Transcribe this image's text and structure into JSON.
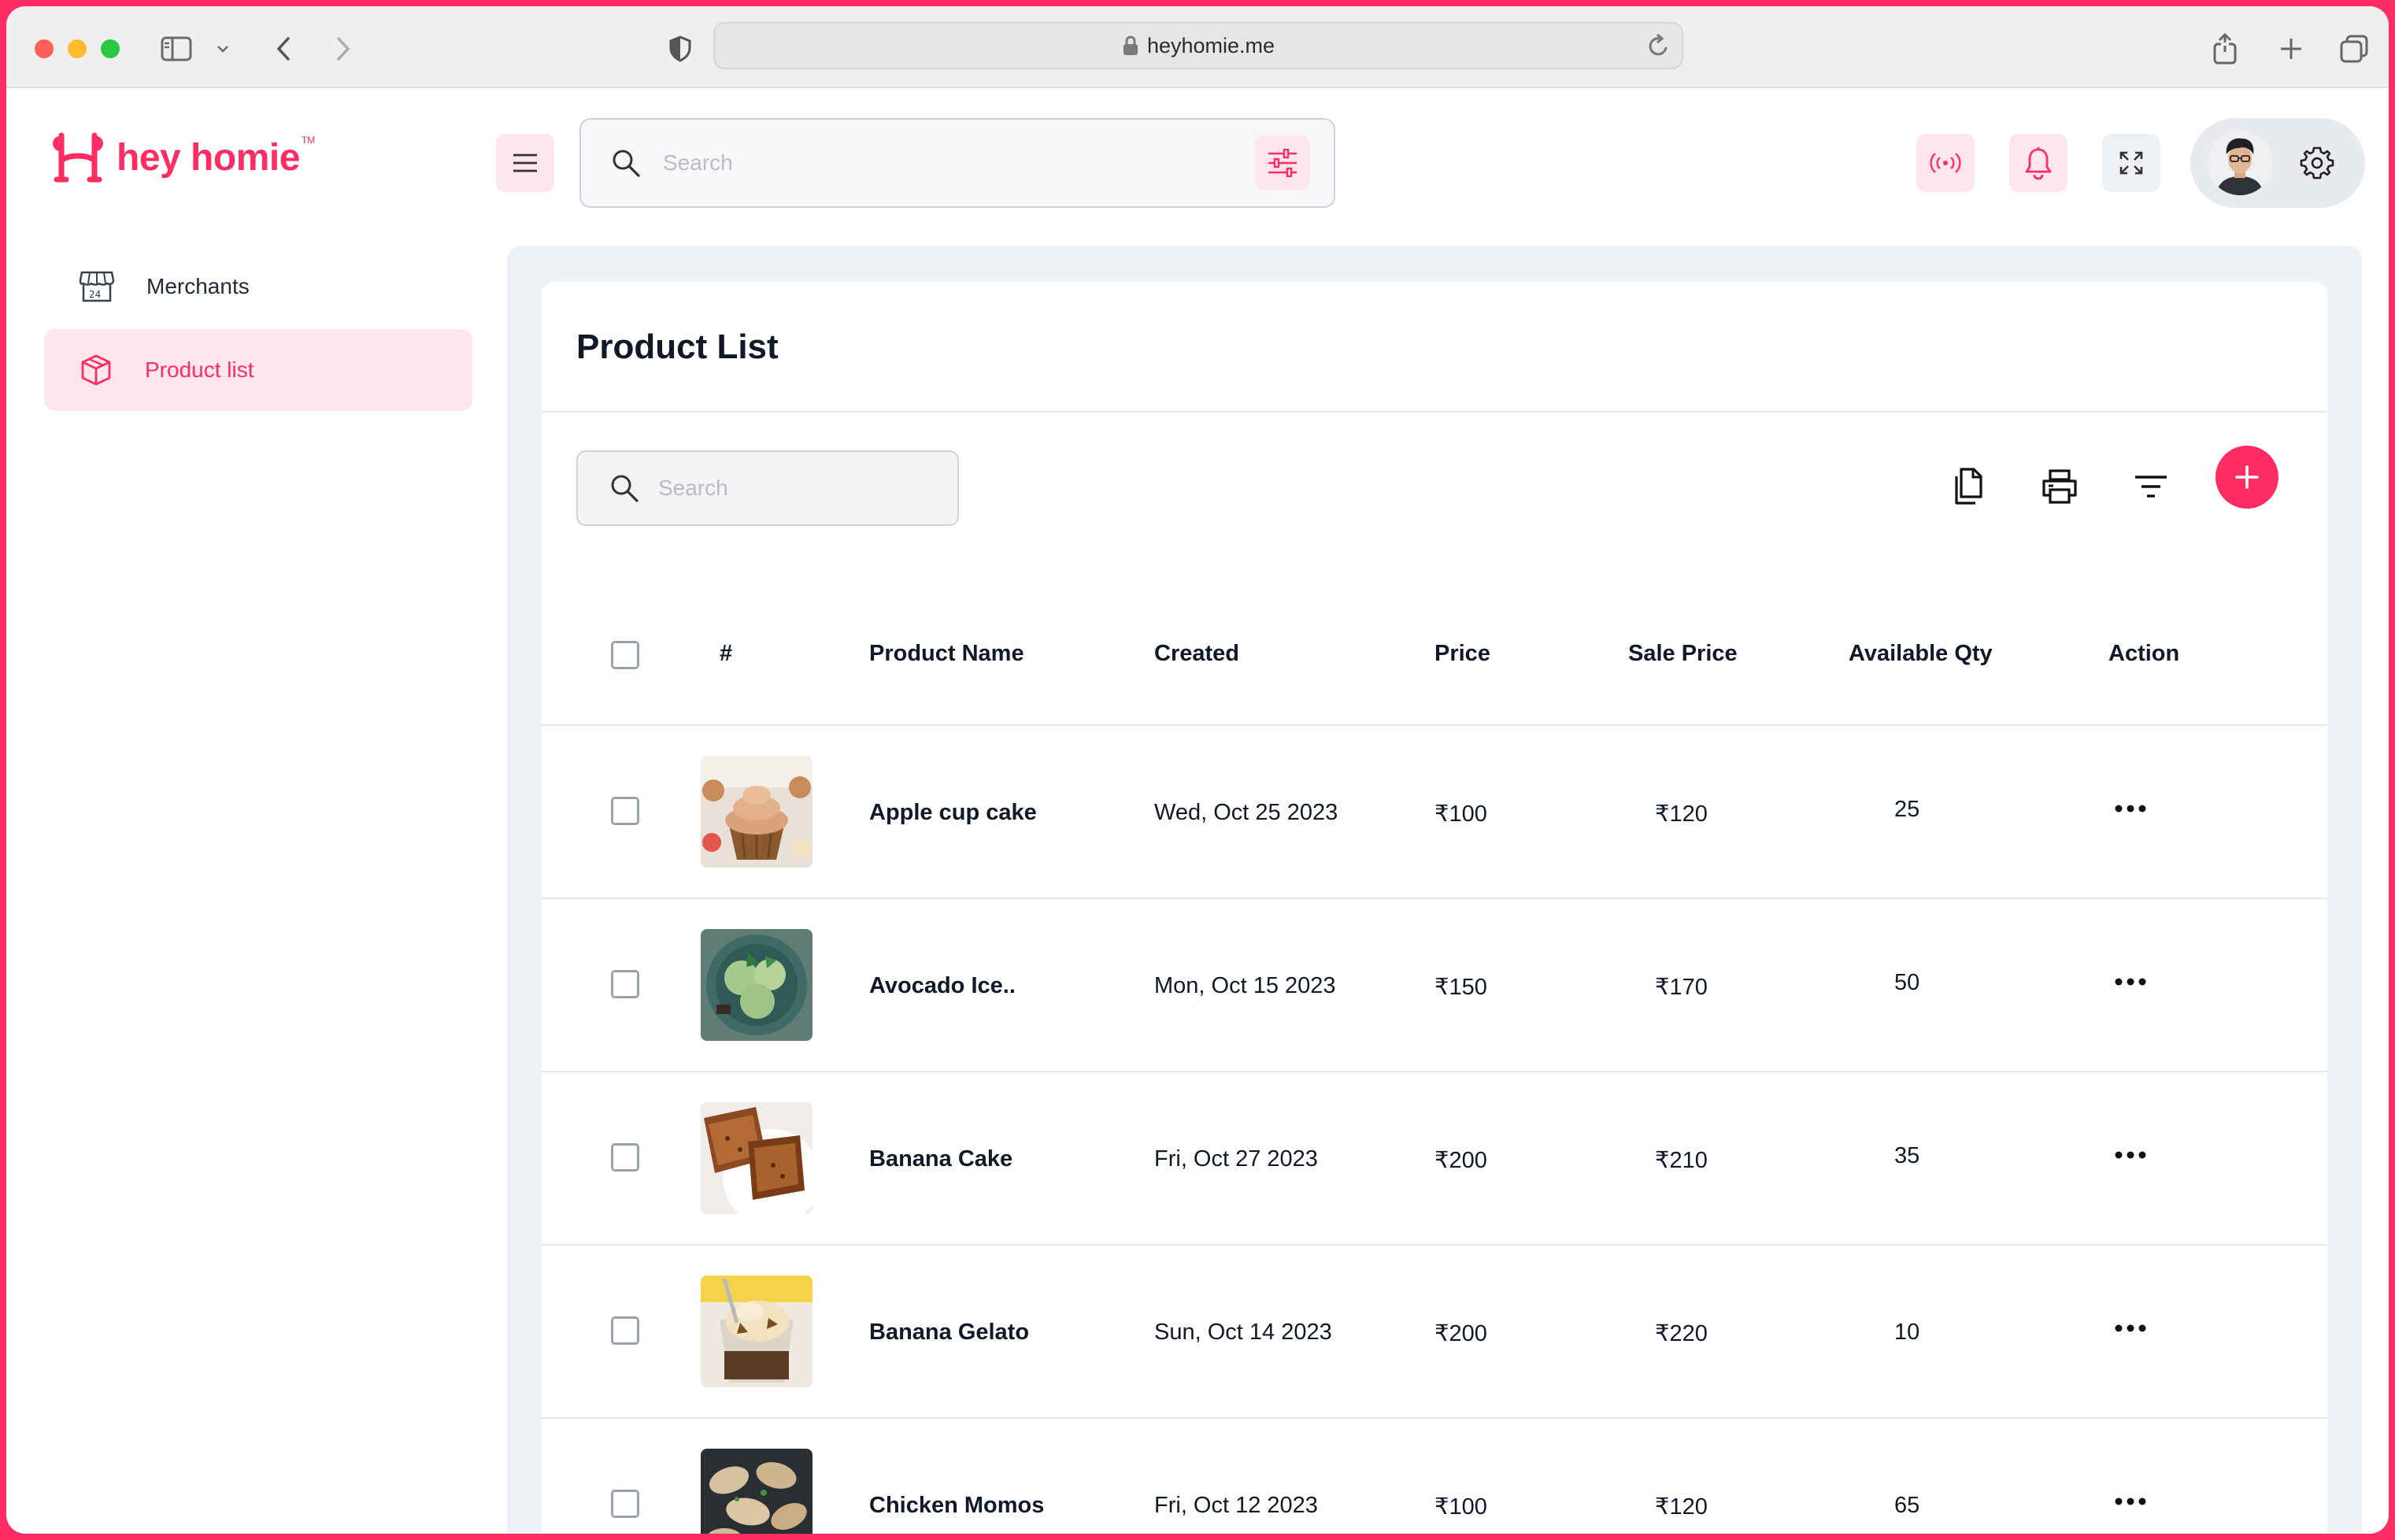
{
  "browser": {
    "url": "heyhomie.me",
    "icons": [
      "sidebar-icon",
      "chevron-down-icon",
      "back-icon",
      "forward-icon",
      "shield-icon",
      "lock-icon",
      "reload-icon",
      "share-icon",
      "plus-icon",
      "tabs-icon"
    ]
  },
  "brand": {
    "name": "hey homie",
    "tm": "TM",
    "color": "#ff2d63"
  },
  "sidebar": {
    "items": [
      {
        "label": "Merchants",
        "icon": "store-icon",
        "active": false
      },
      {
        "label": "Product list",
        "icon": "box-icon",
        "active": true
      }
    ]
  },
  "header": {
    "search_placeholder": "Search",
    "icons": [
      "menu-icon",
      "search-icon",
      "sliders-icon",
      "broadcast-icon",
      "bell-icon",
      "expand-icon",
      "avatar",
      "gear-icon"
    ]
  },
  "product_list": {
    "title": "Product List",
    "search_placeholder": "Search",
    "toolbar": [
      "copy-icon",
      "print-icon",
      "filter-icon",
      "add-icon"
    ],
    "columns": [
      "#",
      "Product Name",
      "Created",
      "Price",
      "Sale Price",
      "Available Qty",
      "Action"
    ],
    "rows": [
      {
        "name": "Apple cup cake",
        "created": "Wed, Oct 25 2023",
        "price": "₹100",
        "sale_price": "₹120",
        "qty": "25",
        "image": "cupcake"
      },
      {
        "name": "Avocado Ice..",
        "created": "Mon, Oct 15 2023",
        "price": "₹150",
        "sale_price": "₹170",
        "qty": "50",
        "image": "green-ice-cream"
      },
      {
        "name": "Banana Cake",
        "created": "Fri, Oct 27 2023",
        "price": "₹200",
        "sale_price": "₹210",
        "qty": "35",
        "image": "banana-cake"
      },
      {
        "name": "Banana Gelato",
        "created": "Sun, Oct 14 2023",
        "price": "₹200",
        "sale_price": "₹220",
        "qty": "10",
        "image": "gelato"
      },
      {
        "name": "Chicken Momos",
        "created": "Fri, Oct 12 2023",
        "price": "₹100",
        "sale_price": "₹120",
        "qty": "65",
        "image": "momos"
      }
    ]
  }
}
